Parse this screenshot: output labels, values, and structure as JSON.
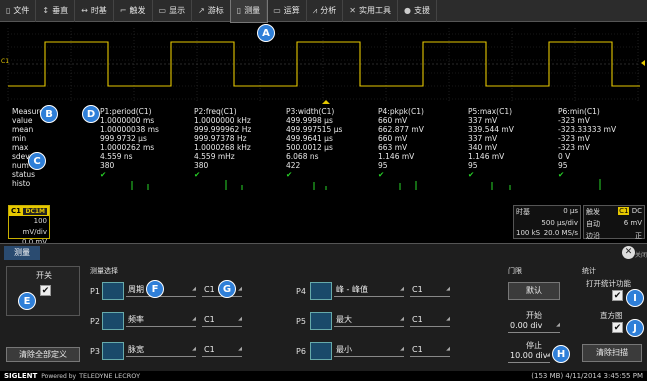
{
  "menu": [
    {
      "icon": "file-icon",
      "glyph": "▯",
      "label": "文件"
    },
    {
      "icon": "vertical-icon",
      "glyph": "↕",
      "label": "垂直"
    },
    {
      "icon": "timebase-icon",
      "glyph": "↔",
      "label": "时基"
    },
    {
      "icon": "trigger-icon",
      "glyph": "⌐",
      "label": "触发"
    },
    {
      "icon": "display-icon",
      "glyph": "▭",
      "label": "显示"
    },
    {
      "icon": "cursor-icon",
      "glyph": "↗",
      "label": "游标"
    },
    {
      "icon": "measure-icon",
      "glyph": "▯",
      "label": "测量"
    },
    {
      "icon": "math-icon",
      "glyph": "▭",
      "label": "运算"
    },
    {
      "icon": "analysis-icon",
      "glyph": "⩘",
      "label": "分析"
    },
    {
      "icon": "utility-icon",
      "glyph": "✕",
      "label": "实用工具"
    },
    {
      "icon": "support-icon",
      "glyph": "●",
      "label": "支援"
    }
  ],
  "markers": {
    "a": "A",
    "b": "B",
    "c": "C",
    "d": "D",
    "e": "E",
    "f": "F",
    "g": "G",
    "h": "H",
    "i": "I",
    "j": "J"
  },
  "scope": {
    "channel_label": "C1"
  },
  "measure": {
    "header": [
      "Measure",
      "P1:period(C1)",
      "P2:freq(C1)",
      "P3:width(C1)",
      "P4:pkpk(C1)",
      "P5:max(C1)",
      "P6:min(C1)"
    ],
    "rows": [
      [
        "value",
        "1.0000000 ms",
        "1.0000000 kHz",
        "499.9998 µs",
        "660 mV",
        "337 mV",
        "-323 mV"
      ],
      [
        "mean",
        "1.00000038 ms",
        "999.999962 Hz",
        "499.997515 µs",
        "662.877 mV",
        "339.544 mV",
        "-323.33333 mV"
      ],
      [
        "min",
        "999.9732 µs",
        "999.97378 Hz",
        "499.9641 µs",
        "660 mV",
        "337 mV",
        "-323 mV"
      ],
      [
        "max",
        "1.0000262 ms",
        "1.0000268 kHz",
        "500.0012 µs",
        "663 mV",
        "340 mV",
        "-323 mV"
      ],
      [
        "sdev",
        "4.559 ns",
        "4.559 mHz",
        "6.068 ns",
        "1.146 mV",
        "1.146 mV",
        "0 V"
      ],
      [
        "num",
        "380",
        "380",
        "422",
        "95",
        "95",
        "95"
      ]
    ],
    "status_label": "status",
    "status_check": "✔",
    "histo_label": "histo"
  },
  "ch1": {
    "name": "C1",
    "coupling": "DC1M",
    "scale": "100 mV/div",
    "offset": "0.0 mV offset"
  },
  "timebase": {
    "title": "时基",
    "delay": "0 µs",
    "scale": "500 µs/div",
    "points": "100 kS",
    "rate": "20.0 MS/s"
  },
  "trigger": {
    "title": "触发",
    "channel": "C1",
    "coupling": "DC",
    "mode": "自动",
    "level": "6 mV",
    "type": "边沿",
    "slope": "正"
  },
  "panel": {
    "tab": "测量",
    "close_glyph": "✕",
    "close_label": "关闭",
    "onoff_label": "开关",
    "clear_all": "清除全部定义",
    "select_title": "测量选择",
    "params": [
      {
        "slot": "P1",
        "name": "周期",
        "source": "C1"
      },
      {
        "slot": "P2",
        "name": "频率",
        "source": "C1"
      },
      {
        "slot": "P3",
        "name": "脉宽",
        "source": "C1"
      },
      {
        "slot": "P4",
        "name": "峰 - 峰值",
        "source": "C1"
      },
      {
        "slot": "P5",
        "name": "最大",
        "source": "C1"
      },
      {
        "slot": "P6",
        "name": "最小",
        "source": "C1"
      }
    ],
    "gate_title": "门限",
    "default_btn": "默认",
    "start_label": "开始",
    "start_value": "0.00 div",
    "stop_label": "停止",
    "stop_value": "10.00 div",
    "stats_title": "统计",
    "stats_on": "打开统计功能",
    "histogram": "直方图",
    "clear_sweeps": "清除扫描"
  },
  "status": {
    "brand": "SIGLENT",
    "powered": "Powered by",
    "partner": "TELEDYNE LECROY",
    "info": "(153 MB) 4/11/2014 3:45:55 PM"
  }
}
